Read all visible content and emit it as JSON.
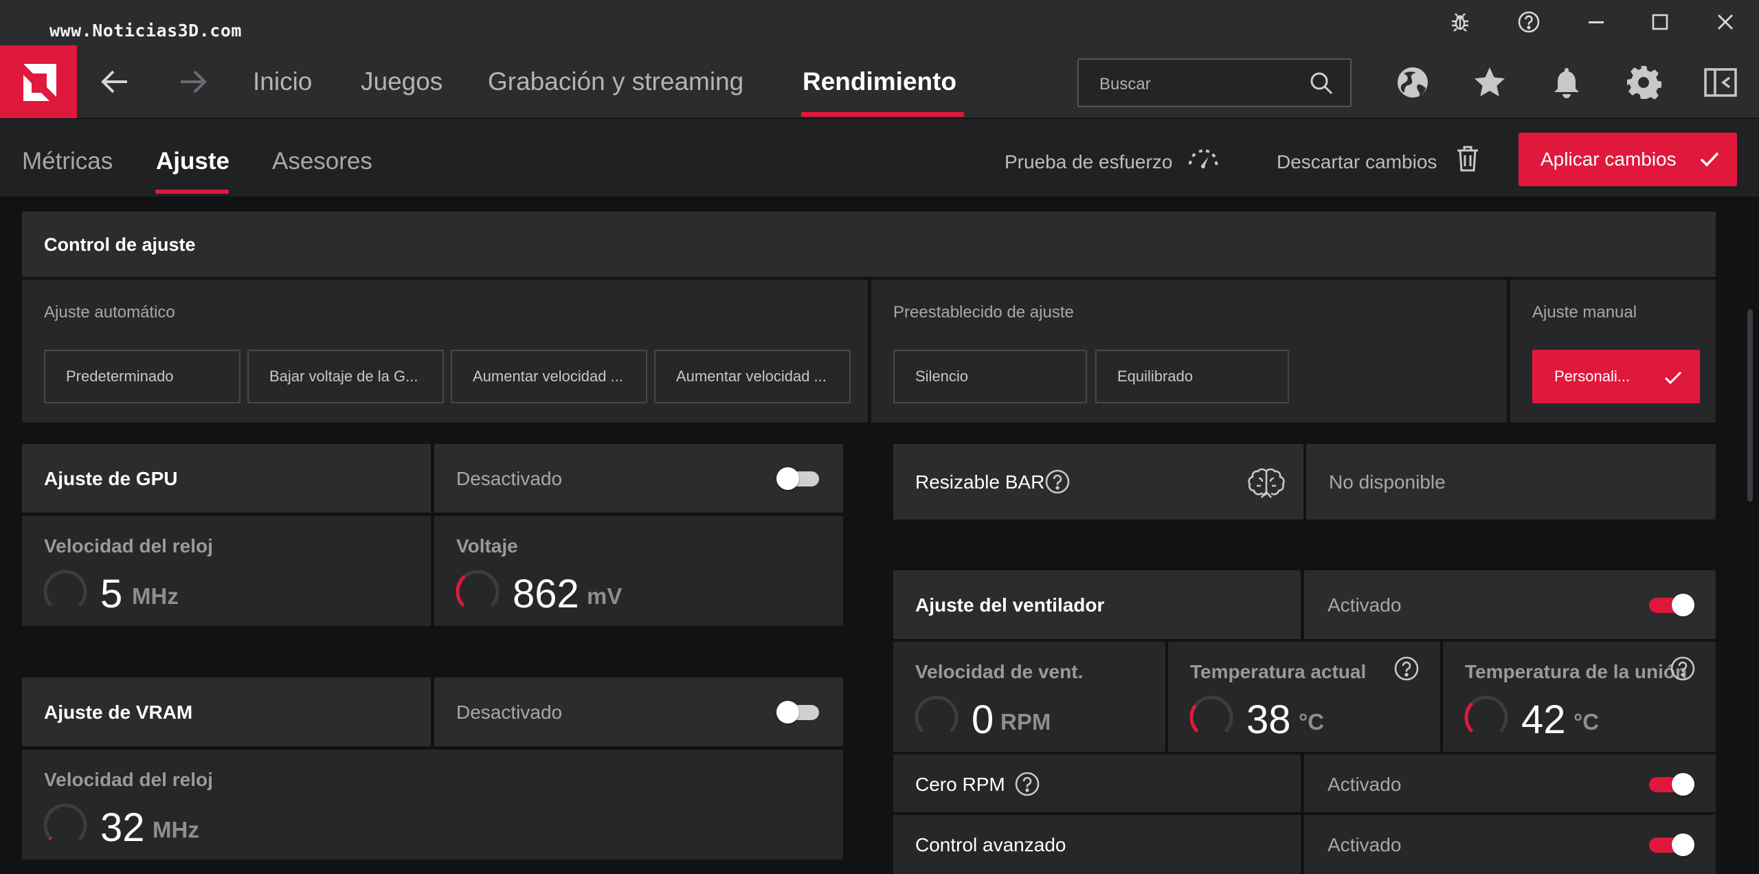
{
  "watermark": "www.Noticias3D.com",
  "window_controls": [
    "bug-icon",
    "help-icon",
    "minimize-icon",
    "maximize-icon",
    "close-icon"
  ],
  "nav": {
    "tabs": [
      {
        "label": "Inicio",
        "active": false
      },
      {
        "label": "Juegos",
        "active": false
      },
      {
        "label": "Grabación y streaming",
        "active": false
      },
      {
        "label": "Rendimiento",
        "active": true
      }
    ],
    "search_placeholder": "Buscar",
    "icons": [
      "globe-icon",
      "star-icon",
      "bell-icon",
      "gear-icon",
      "sidebar-icon"
    ]
  },
  "subnav": {
    "tabs": [
      {
        "label": "Métricas",
        "active": false
      },
      {
        "label": "Ajuste",
        "active": true
      },
      {
        "label": "Asesores",
        "active": false
      }
    ],
    "stress_test": "Prueba de esfuerzo",
    "discard": "Descartar cambios",
    "apply": "Aplicar cambios"
  },
  "tuning_control": {
    "title": "Control de ajuste",
    "auto": {
      "label": "Ajuste automático",
      "options": [
        "Predeterminado",
        "Bajar voltaje de la G...",
        "Aumentar velocidad ...",
        "Aumentar velocidad ..."
      ]
    },
    "preset": {
      "label": "Preestablecido de ajuste",
      "options": [
        "Silencio",
        "Equilibrado"
      ]
    },
    "manual": {
      "label": "Ajuste manual",
      "option": "Personali..."
    }
  },
  "gpu_tuning": {
    "title": "Ajuste de GPU",
    "status": "Desactivado",
    "enabled": false,
    "clock": {
      "label": "Velocidad del reloj",
      "value": "5",
      "unit": "MHz",
      "level": 0.0
    },
    "voltage": {
      "label": "Voltaje",
      "value": "862",
      "unit": "mV",
      "level": 0.35
    }
  },
  "vram_tuning": {
    "title": "Ajuste de VRAM",
    "status": "Desactivado",
    "enabled": false,
    "clock": {
      "label": "Velocidad del reloj",
      "value": "32",
      "unit": "MHz",
      "level": 0.02
    }
  },
  "resizable_bar": {
    "title": "Resizable BAR",
    "status": "No disponible"
  },
  "fan_tuning": {
    "title": "Ajuste del ventilador",
    "status": "Activado",
    "enabled": true,
    "fan_speed": {
      "label": "Velocidad de vent.",
      "value": "0",
      "unit": "RPM",
      "level": 0.0
    },
    "current_temp": {
      "label": "Temperatura actual",
      "value": "38",
      "unit": "°C",
      "level": 0.3
    },
    "junction_temp": {
      "label": "Temperatura de la unión",
      "value": "42",
      "unit": "°C",
      "level": 0.33
    },
    "zero_rpm": {
      "label": "Cero RPM",
      "status": "Activado",
      "enabled": true
    },
    "advanced": {
      "label": "Control avanzado",
      "status": "Activado",
      "enabled": true
    }
  },
  "colors": {
    "accent": "#e0183c",
    "background": "#111214",
    "panel": "#262729"
  }
}
